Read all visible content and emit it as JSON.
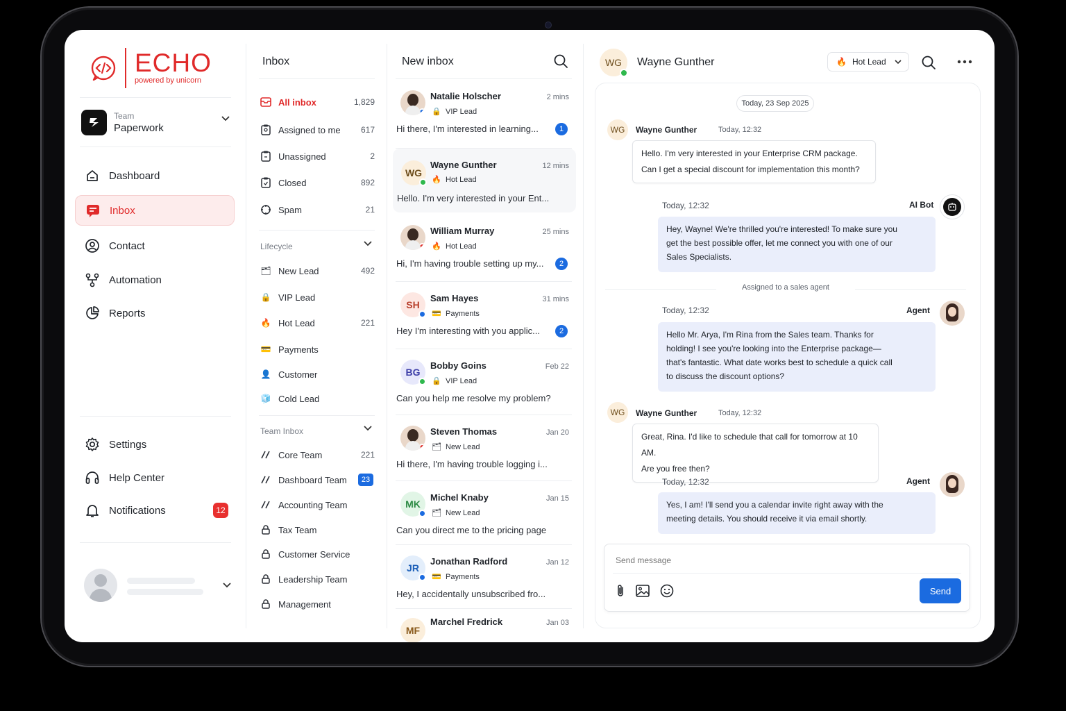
{
  "brand": {
    "name": "ECHO",
    "tagline": "powered by unicorn",
    "color": "#e02a2a"
  },
  "team": {
    "label": "Team",
    "name": "Paperwork"
  },
  "nav": {
    "items": [
      {
        "label": "Dashboard",
        "icon": "dashboard-icon"
      },
      {
        "label": "Inbox",
        "icon": "inbox-icon",
        "active": true
      },
      {
        "label": "Contact",
        "icon": "contact-icon"
      },
      {
        "label": "Automation",
        "icon": "automation-icon"
      },
      {
        "label": "Reports",
        "icon": "reports-icon"
      }
    ],
    "bottom": [
      {
        "label": "Settings",
        "icon": "gear-icon"
      },
      {
        "label": "Help Center",
        "icon": "headset-icon"
      },
      {
        "label": "Notifications",
        "icon": "bell-icon",
        "badge": "12"
      }
    ]
  },
  "inbox_filters": {
    "title": "Inbox",
    "items": [
      {
        "label": "All inbox",
        "count": "1,829",
        "active": true
      },
      {
        "label": "Assigned to me",
        "count": "617"
      },
      {
        "label": "Unassigned",
        "count": "2"
      },
      {
        "label": "Closed",
        "count": "892"
      },
      {
        "label": "Spam",
        "count": "21"
      }
    ],
    "lifecycle_title": "Lifecycle",
    "lifecycle": [
      {
        "label": "New Lead",
        "count": "492",
        "emoji": "🗂"
      },
      {
        "label": "VIP Lead",
        "count": "",
        "emoji": "🔒"
      },
      {
        "label": "Hot Lead",
        "count": "221",
        "emoji": "🔥"
      },
      {
        "label": "Payments",
        "count": "",
        "emoji": "💳"
      },
      {
        "label": "Customer",
        "count": "",
        "emoji": "👤"
      },
      {
        "label": "Cold Lead",
        "count": "",
        "emoji": "🧊"
      }
    ],
    "team_title": "Team Inbox",
    "teams": [
      {
        "label": "Core Team",
        "count": "221",
        "icon": "slash-icon"
      },
      {
        "label": "Dashboard Team",
        "badge": "23",
        "icon": "slash-icon"
      },
      {
        "label": "Accounting Team",
        "icon": "slash-icon"
      },
      {
        "label": "Tax Team",
        "icon": "lock-icon"
      },
      {
        "label": "Customer Service",
        "icon": "lock-icon"
      },
      {
        "label": "Leadership Team",
        "icon": "lock-icon"
      },
      {
        "label": "Management",
        "icon": "lock-icon"
      }
    ]
  },
  "conversation_list": {
    "title": "New inbox",
    "items": [
      {
        "name": "Natalie Holscher",
        "time": "2 mins",
        "tag": "VIP Lead",
        "tag_emoji": "🔒",
        "preview": "Hi there, I'm interested in learning...",
        "unread": "1",
        "avatar": "photo"
      },
      {
        "name": "Wayne Gunther",
        "time": "12 mins",
        "tag": "Hot Lead",
        "tag_emoji": "🔥",
        "preview": "Hello. I'm very interested in your Ent...",
        "initials": "WG",
        "selected": true
      },
      {
        "name": "William Murray",
        "time": "25 mins",
        "tag": "Hot Lead",
        "tag_emoji": "🔥",
        "preview": "Hi, I'm having trouble setting up my...",
        "unread": "2",
        "avatar": "photo"
      },
      {
        "name": "Sam Hayes",
        "time": "31 mins",
        "tag": "Payments",
        "tag_emoji": "💳",
        "preview": "Hey I'm interesting with you applic...",
        "unread": "2",
        "initials": "SH"
      },
      {
        "name": "Bobby Goins",
        "time": "Feb 22",
        "tag": "VIP Lead",
        "tag_emoji": "🔒",
        "preview": "Can you help me resolve my problem?",
        "initials": "BG"
      },
      {
        "name": "Steven Thomas",
        "time": "Jan 20",
        "tag": "New Lead",
        "tag_emoji": "🗂",
        "preview": "Hi there, I'm having trouble logging i...",
        "avatar": "photo"
      },
      {
        "name": "Michel Knaby",
        "time": "Jan 15",
        "tag": "New Lead",
        "tag_emoji": "🗂",
        "preview": "Can you direct me to the pricing page",
        "initials": "MK"
      },
      {
        "name": "Jonathan Radford",
        "time": "Jan 12",
        "tag": "Payments",
        "tag_emoji": "💳",
        "preview": "Hey, I accidentally unsubscribed fro...",
        "initials": "JR"
      },
      {
        "name": "Marchel Fredrick",
        "time": "Jan 03",
        "initials": "MF"
      }
    ]
  },
  "chat": {
    "contact_initials": "WG",
    "contact_name": "Wayne Gunther",
    "lead_status": "Hot Lead",
    "lead_emoji": "🔥",
    "date_label": "Today, 23 Sep 2025",
    "system_note": "Assigned to a sales agent",
    "messages": [
      {
        "from": "Wayne Gunther",
        "initials": "WG",
        "time": "Today, 12:32",
        "lines": [
          "Hello. I'm very interested in your Enterprise CRM package.",
          "Can I get a special discount for implementation this month?"
        ]
      },
      {
        "from": "AI Bot",
        "time": "Today, 12:32",
        "lines": [
          "Hey, Wayne! We're thrilled you're interested! To make sure you",
          "get the best possible offer, let me connect you with one of our",
          "Sales Specialists."
        ]
      },
      {
        "from": "Agent",
        "time": "Today, 12:32",
        "lines": [
          "Hello Mr. Arya, I'm Rina from the Sales team. Thanks for",
          "holding! I see you're looking into the Enterprise package—",
          "that's fantastic. What date works best to schedule a quick call",
          "to discuss the discount options?"
        ]
      },
      {
        "from": "Wayne Gunther",
        "initials": "WG",
        "time": "Today, 12:32",
        "lines": [
          "Great, Rina. I'd like to schedule that call for tomorrow at 10 AM.",
          "Are you free then?"
        ]
      },
      {
        "from": "Agent",
        "time": "Today, 12:32",
        "lines": [
          "Yes, I am! I'll send you a calendar invite right away with the",
          "meeting details. You should receive it via email shortly."
        ]
      }
    ],
    "composer_placeholder": "Send message",
    "send_label": "Send"
  },
  "colors": {
    "accent": "#e02a2a",
    "primary": "#1b6be0",
    "online": "#2fb84d",
    "offline": "#e0342f"
  }
}
